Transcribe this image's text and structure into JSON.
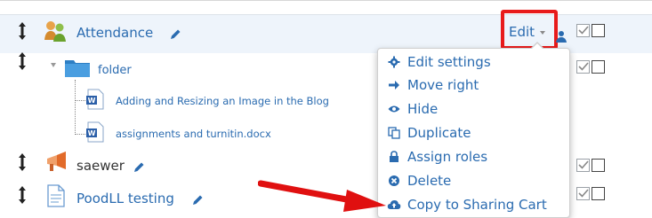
{
  "colors": {
    "link": "#2a6bb0",
    "highlight_red": "#e81b1b",
    "row_highlight_bg": "#eef4fb",
    "arrow_red": "#e01010"
  },
  "activities": [
    {
      "name": "Attendance",
      "icon": "attendance-icon"
    },
    {
      "name": "folder",
      "icon": "folder-icon",
      "expanded": true,
      "children": [
        {
          "name": "Adding and Resizing an Image in the Blog",
          "icon": "word-doc-icon"
        },
        {
          "name": "assignments and turnitin.docx",
          "icon": "word-doc-icon"
        }
      ]
    },
    {
      "name": "saewer",
      "icon": "megaphone-icon"
    },
    {
      "name": "PoodLL testing",
      "icon": "page-icon"
    }
  ],
  "edit_menu": {
    "trigger_label": "Edit",
    "items": [
      {
        "label": "Edit settings",
        "icon": "gear-icon"
      },
      {
        "label": "Move right",
        "icon": "arrow-right-icon"
      },
      {
        "label": "Hide",
        "icon": "eye-icon"
      },
      {
        "label": "Duplicate",
        "icon": "duplicate-icon"
      },
      {
        "label": "Assign roles",
        "icon": "lock-icon"
      },
      {
        "label": "Delete",
        "icon": "delete-icon"
      },
      {
        "label": "Copy to Sharing Cart",
        "icon": "cloud-upload-icon"
      }
    ]
  }
}
